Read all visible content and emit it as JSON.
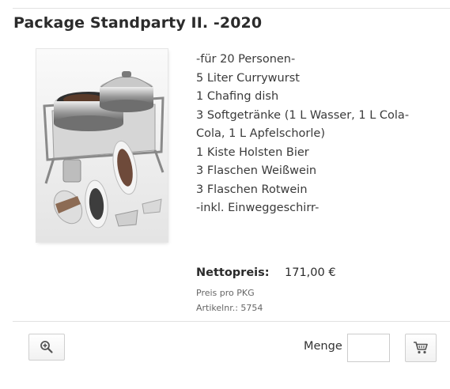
{
  "product": {
    "title": "Package Standparty II. -2020",
    "image_alt": "Chafing dish with currywurst and side dishes",
    "description": [
      "-für 20 Personen-",
      "5 Liter Currywurst",
      "1 Chafing dish",
      "3 Softgetränke (1 L Wasser, 1 L Cola-",
      "Cola, 1 L Apfelschorle)",
      "1 Kiste Holsten Bier",
      "3 Flaschen Weißwein",
      "3 Flaschen Rotwein",
      "-inkl. Einweggeschirr-"
    ],
    "price_label": "Nettopreis:",
    "price_value": "171,00 €",
    "price_unit": "Preis pro PKG",
    "article_number": "Artikelnr.: 5754"
  },
  "actions": {
    "zoom_icon": "zoom-in-icon",
    "quantity_label": "Menge",
    "quantity_value": "",
    "cart_icon": "shopping-cart-icon"
  }
}
